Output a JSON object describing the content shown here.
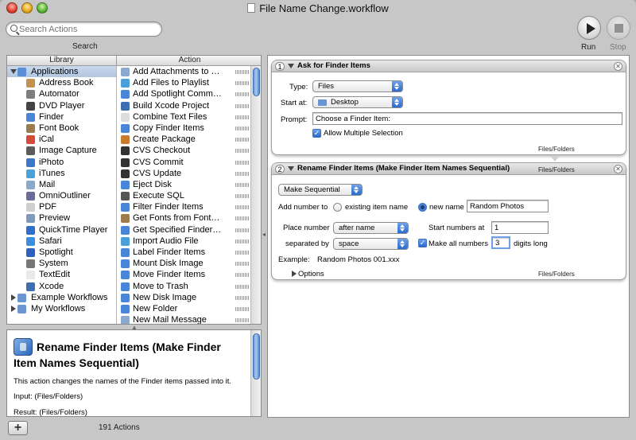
{
  "window": {
    "title": "File Name Change.workflow"
  },
  "toolbar": {
    "search_placeholder": "Search Actions",
    "search_label": "Search",
    "run_label": "Run",
    "stop_label": "Stop"
  },
  "library": {
    "header": "Library",
    "items": [
      {
        "label": "Applications",
        "icon": "applications-folder-icon",
        "color": "#5a8fd6",
        "level": 0,
        "expanded": true
      },
      {
        "label": "Address Book",
        "icon": "address-book-icon",
        "color": "#c4914f",
        "level": 1
      },
      {
        "label": "Automator",
        "icon": "automator-icon",
        "color": "#7d7d7d",
        "level": 1
      },
      {
        "label": "DVD Player",
        "icon": "dvd-player-icon",
        "color": "#444444",
        "level": 1
      },
      {
        "label": "Finder",
        "icon": "finder-icon",
        "color": "#4a86d8",
        "level": 1
      },
      {
        "label": "Font Book",
        "icon": "font-book-icon",
        "color": "#9c7b4d",
        "level": 1
      },
      {
        "label": "iCal",
        "icon": "ical-icon",
        "color": "#d64a3a",
        "level": 1
      },
      {
        "label": "Image Capture",
        "icon": "image-capture-icon",
        "color": "#5b5b5b",
        "level": 1
      },
      {
        "label": "iPhoto",
        "icon": "iphoto-icon",
        "color": "#3b78c9",
        "level": 1
      },
      {
        "label": "iTunes",
        "icon": "itunes-icon",
        "color": "#4aa0d8",
        "level": 1
      },
      {
        "label": "Mail",
        "icon": "mail-icon",
        "color": "#8aa9cc",
        "level": 1
      },
      {
        "label": "OmniOutliner",
        "icon": "omnioutliner-icon",
        "color": "#6b6b9c",
        "level": 1
      },
      {
        "label": "PDF",
        "icon": "pdf-icon",
        "color": "#cfcfcf",
        "level": 1
      },
      {
        "label": "Preview",
        "icon": "preview-icon",
        "color": "#7f99bd",
        "level": 1
      },
      {
        "label": "QuickTime Player",
        "icon": "quicktime-icon",
        "color": "#2f6fcc",
        "level": 1
      },
      {
        "label": "Safari",
        "icon": "safari-icon",
        "color": "#3c8ee0",
        "level": 1
      },
      {
        "label": "Spotlight",
        "icon": "spotlight-icon",
        "color": "#2e62c0",
        "level": 1
      },
      {
        "label": "System",
        "icon": "system-icon",
        "color": "#777777",
        "level": 1
      },
      {
        "label": "TextEdit",
        "icon": "textedit-icon",
        "color": "#e9e9e9",
        "level": 1
      },
      {
        "label": "Xcode",
        "icon": "xcode-icon",
        "color": "#3f6fb3",
        "level": 1
      },
      {
        "label": "Example Workflows",
        "icon": "example-workflows-folder-icon",
        "color": "#6b95d3",
        "level": 0,
        "expanded": false
      },
      {
        "label": "My Workflows",
        "icon": "my-workflows-folder-icon",
        "color": "#6b95d3",
        "level": 0,
        "expanded": false
      }
    ]
  },
  "actions": {
    "header": "Action",
    "items": [
      {
        "label": "Add Attachments to Front …",
        "icon": "mail-action-icon",
        "color": "#8aa9cc"
      },
      {
        "label": "Add Files to Playlist",
        "icon": "itunes-action-icon",
        "color": "#4aa0d8"
      },
      {
        "label": "Add Spotlight Comments t…",
        "icon": "finder-action-icon",
        "color": "#4a86d8"
      },
      {
        "label": "Build Xcode Project",
        "icon": "xcode-action-icon",
        "color": "#3f6fb3"
      },
      {
        "label": "Combine Text Files",
        "icon": "textedit-action-icon",
        "color": "#dcdcdc"
      },
      {
        "label": "Copy Finder Items",
        "icon": "finder-action-icon",
        "color": "#4a86d8"
      },
      {
        "label": "Create Package",
        "icon": "package-action-icon",
        "color": "#c87a2e"
      },
      {
        "label": "CVS Checkout",
        "icon": "terminal-action-icon",
        "color": "#333333"
      },
      {
        "label": "CVS Commit",
        "icon": "terminal-action-icon",
        "color": "#333333"
      },
      {
        "label": "CVS Update",
        "icon": "terminal-action-icon",
        "color": "#333333"
      },
      {
        "label": "Eject Disk",
        "icon": "finder-action-icon",
        "color": "#4a86d8"
      },
      {
        "label": "Execute SQL",
        "icon": "sql-action-icon",
        "color": "#555555"
      },
      {
        "label": "Filter Finder Items",
        "icon": "finder-action-icon",
        "color": "#4a86d8"
      },
      {
        "label": "Get Fonts from Font Files",
        "icon": "font-book-action-icon",
        "color": "#9c7b4d"
      },
      {
        "label": "Get Specified Finder Items",
        "icon": "finder-action-icon",
        "color": "#4a86d8"
      },
      {
        "label": "Import Audio File",
        "icon": "itunes-action-icon",
        "color": "#4aa0d8"
      },
      {
        "label": "Label Finder Items",
        "icon": "finder-action-icon",
        "color": "#4a86d8"
      },
      {
        "label": "Mount Disk Image",
        "icon": "finder-action-icon",
        "color": "#4a86d8"
      },
      {
        "label": "Move Finder Items",
        "icon": "finder-action-icon",
        "color": "#4a86d8"
      },
      {
        "label": "Move to Trash",
        "icon": "finder-action-icon",
        "color": "#4a86d8"
      },
      {
        "label": "New Disk Image",
        "icon": "finder-action-icon",
        "color": "#4a86d8"
      },
      {
        "label": "New Folder",
        "icon": "finder-action-icon",
        "color": "#4a86d8"
      },
      {
        "label": "New Mail Message",
        "icon": "mail-action-icon",
        "color": "#8aa9cc"
      }
    ]
  },
  "description": {
    "title": "Rename Finder Items (Make Finder Item Names Sequential)",
    "text": "This action changes the names of the Finder items passed into it.",
    "input": "Input: (Files/Folders)",
    "result": "Result: (Files/Folders)"
  },
  "footer": {
    "add_label": "+",
    "count_label": "191 Actions"
  },
  "workflow": {
    "step1": {
      "number": "1",
      "title": "Ask for Finder Items",
      "type_label": "Type:",
      "type_value": "Files",
      "start_label": "Start at:",
      "start_value": "Desktop",
      "prompt_label": "Prompt:",
      "prompt_value": "Choose a Finder Item:",
      "allow_multiple_label": "Allow Multiple Selection",
      "allow_multiple_checked": true,
      "output_tag": "Files/Folders"
    },
    "step2": {
      "number": "2",
      "title": "Rename Finder Items (Make Finder Item Names Sequential)",
      "input_tag": "Files/Folders",
      "mode_value": "Make Sequential",
      "add_number_label": "Add number to",
      "existing_name_label": "existing item name",
      "new_name_label": "new name",
      "new_name_selected": true,
      "new_name_value": "Random Photos",
      "place_number_label": "Place number",
      "place_number_value": "after name",
      "start_numbers_label": "Start numbers at",
      "start_numbers_value": "1",
      "separated_by_label": "separated by",
      "separated_by_value": "space",
      "make_all_label": "Make all numbers",
      "make_all_checked": true,
      "make_all_value": "3",
      "digits_long_label": "digits long",
      "example_label": "Example:",
      "example_value": "Random Photos 001.xxx",
      "options_label": "Options",
      "output_tag": "Files/Folders"
    }
  }
}
